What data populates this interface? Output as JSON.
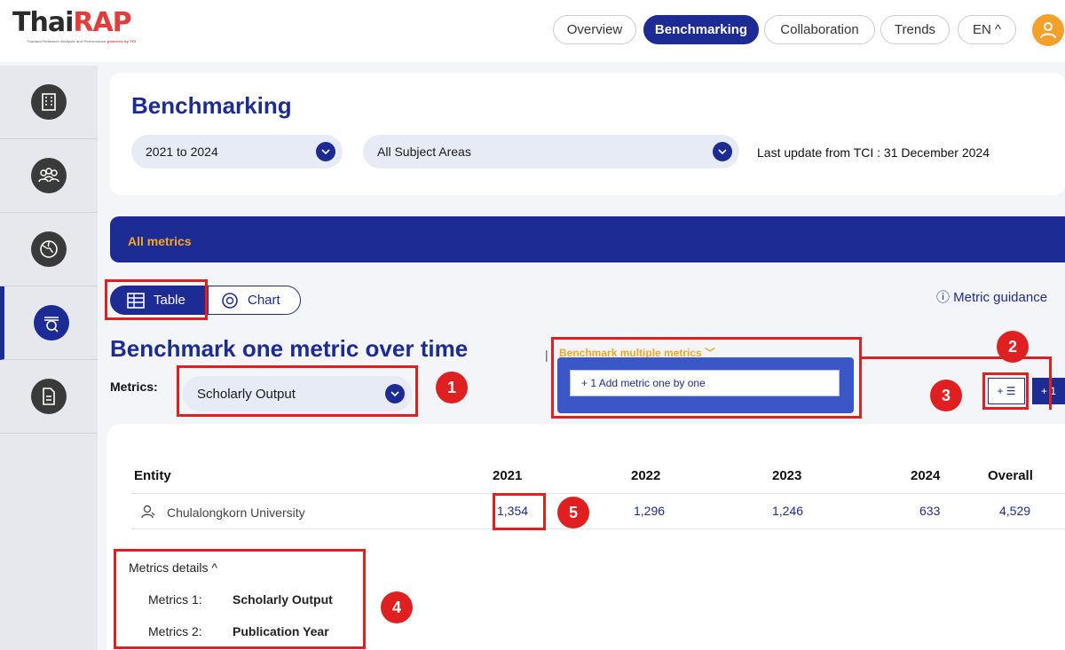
{
  "brand": {
    "name_part1": "Thai",
    "name_part2": "RAP",
    "tagline": "Thailand Research Analysis and Performance",
    "powered_by": "powered by TCI"
  },
  "nav": {
    "items": [
      "Overview",
      "Benchmarking",
      "Collaboration",
      "Trends"
    ],
    "active": "Benchmarking",
    "language": "EN ^"
  },
  "sidebar": {
    "items": [
      "institution-icon",
      "people-icon",
      "globe-icon",
      "benchmark-icon",
      "document-icon"
    ],
    "active_index": 3
  },
  "header": {
    "title": "Benchmarking",
    "year_range": "2021 to 2024",
    "subject_areas": "All Subject Areas",
    "last_update": "Last update from TCI : 31 December 2024"
  },
  "band": {
    "label": "All metrics"
  },
  "view_toggle": {
    "table_label": "Table",
    "chart_label": "Chart",
    "active": "Table"
  },
  "metric_guidance": "ⓘ  Metric guidance",
  "section": {
    "title": "Benchmark one metric over time",
    "separator": "|",
    "multi_label": "Benchmark multiple metrics ﹀",
    "add_metric": "+  1  Add metric one by one"
  },
  "metrics": {
    "label": "Metrics:",
    "selected": "Scholarly Output"
  },
  "actions": {
    "list_add": "+ ☰",
    "plus_one": "+ 1"
  },
  "table": {
    "headers": [
      "Entity",
      "2021",
      "2022",
      "2023",
      "2024",
      "Overall"
    ],
    "rows": [
      {
        "entity": "Chulalongkorn University",
        "values": [
          "1,354",
          "1,296",
          "1,246",
          "633",
          "4,529"
        ]
      }
    ]
  },
  "metrics_details": {
    "title": "Metrics details ^",
    "rows": [
      {
        "label": "Metrics 1:",
        "value": "Scholarly Output"
      },
      {
        "label": "Metrics 2:",
        "value": "Publication Year"
      }
    ]
  },
  "annotations": [
    "1",
    "2",
    "3",
    "4",
    "5"
  ],
  "colors": {
    "primary": "#1d2c94",
    "accent": "#f6a623",
    "annotation": "#e02020",
    "brand_red": "#e53b3b"
  }
}
